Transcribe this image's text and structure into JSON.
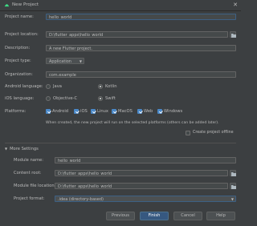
{
  "window": {
    "title": "New Project",
    "close_glyph": "✕"
  },
  "form": {
    "project_name": {
      "label": "Project name:",
      "value": "hello_world"
    },
    "project_location": {
      "label": "Project location:",
      "value": "D:\\flutter_apps\\hello_world"
    },
    "description": {
      "label": "Description:",
      "value": "A new Flutter project."
    },
    "project_type": {
      "label": "Project type:",
      "value": "Application"
    },
    "organization": {
      "label": "Organization:",
      "value": "com.example"
    },
    "android_language": {
      "label": "Android language:",
      "options": [
        "Java",
        "Kotlin"
      ],
      "selected": "Kotlin"
    },
    "ios_language": {
      "label": "iOS language:",
      "options": [
        "Objective-C",
        "Swift"
      ],
      "selected": "Swift"
    },
    "platforms": {
      "label": "Platforms:",
      "items": [
        "Android",
        "iOS",
        "Linux",
        "MacOS",
        "Web",
        "Windows"
      ],
      "all_checked": true
    },
    "platforms_note": "When created, the new project will run on the selected platforms (others can be added later).",
    "create_offline": {
      "label": "Create project offline",
      "checked": false
    }
  },
  "more_settings": {
    "header": "More Settings",
    "module_name": {
      "label": "Module name:",
      "value": "hello_world"
    },
    "content_root": {
      "label": "Content root:",
      "value": "D:\\flutter_apps\\hello_world"
    },
    "module_file_location": {
      "label": "Module file location:",
      "value": "D:\\flutter_apps\\hello_world"
    },
    "project_format": {
      "label": "Project format:",
      "value": ".idea (directory-based)"
    }
  },
  "buttons": {
    "previous": "Previous",
    "finish": "Finish",
    "cancel": "Cancel",
    "help": "Help"
  },
  "colors": {
    "background": "#3c3f41",
    "field": "#45494a",
    "accent": "#4a88c7",
    "primary_button": "#365880"
  }
}
